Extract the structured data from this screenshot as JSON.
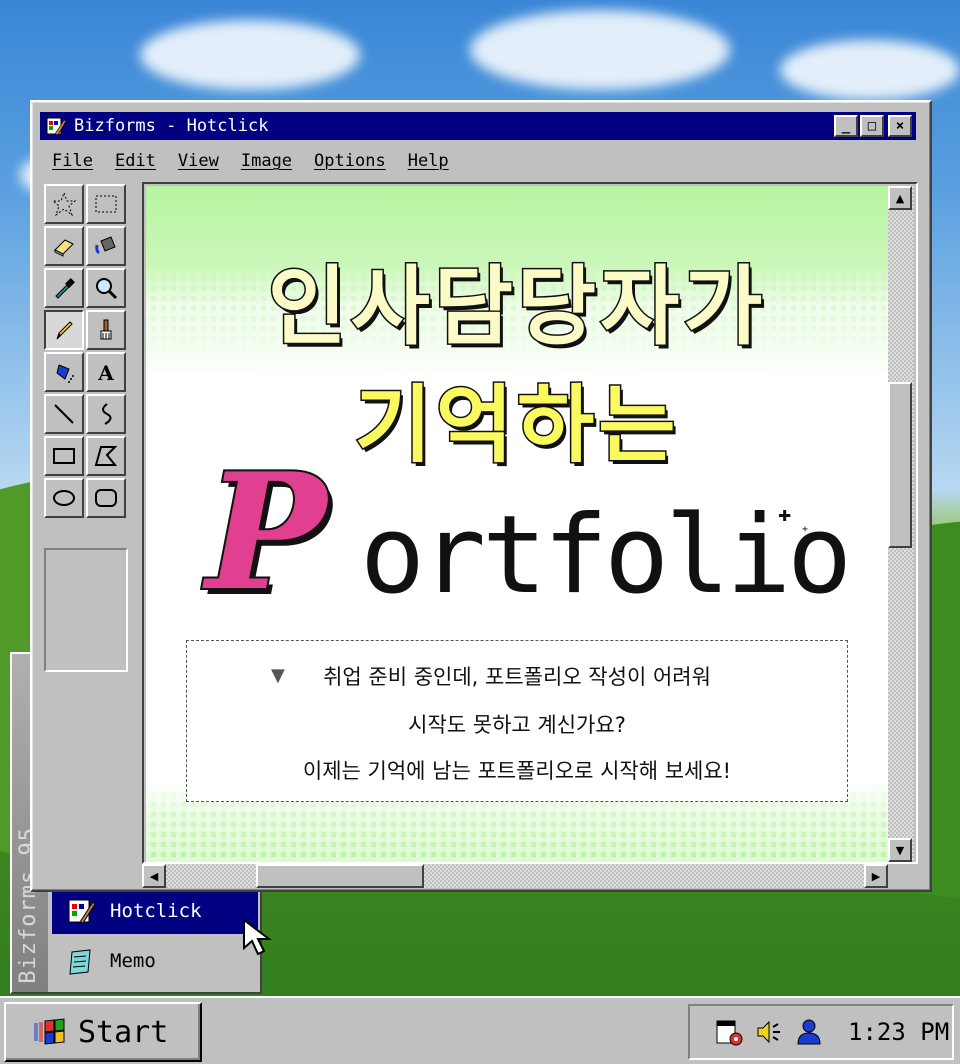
{
  "window": {
    "title": "Bizforms - Hotclick",
    "minimize_glyph": "_",
    "maximize_glyph": "□",
    "close_glyph": "×"
  },
  "menu": [
    "File",
    "Edit",
    "View",
    "Image",
    "Options",
    "Help"
  ],
  "tools": [
    "free-select-icon",
    "rect-select-icon",
    "eraser-icon",
    "fill-bucket-icon",
    "eyedropper-icon",
    "magnifier-icon",
    "pencil-icon",
    "brush-icon",
    "airbrush-icon",
    "text-icon",
    "line-icon",
    "curve-icon",
    "rectangle-icon",
    "polygon-icon",
    "ellipse-icon",
    "rounded-rect-icon"
  ],
  "canvas": {
    "headline_line1": "인사담당자가",
    "headline_line2": "기억하는",
    "script_letter": "P",
    "word_rest": "ortfolio",
    "description": {
      "line1": "취업 준비 중인데, 포트폴리오 작성이 어려워",
      "line2": "시작도 못하고 계신가요?",
      "line3": "이제는 기억에 남는 포트폴리오로 시작해 보세요!"
    }
  },
  "start_menu": {
    "band_label": "Bizforms 95",
    "items": [
      {
        "label": "Hotclick",
        "icon": "paint-icon"
      },
      {
        "label": "Memo",
        "icon": "notepad-icon"
      }
    ]
  },
  "taskbar": {
    "start_label": "Start",
    "clock": "1:23 PM"
  },
  "colors": {
    "titlebar": "#000080",
    "accent_pink": "#e0408f",
    "headline_yellow": "#fafa60",
    "canvas_green": "#b6f5a0"
  }
}
